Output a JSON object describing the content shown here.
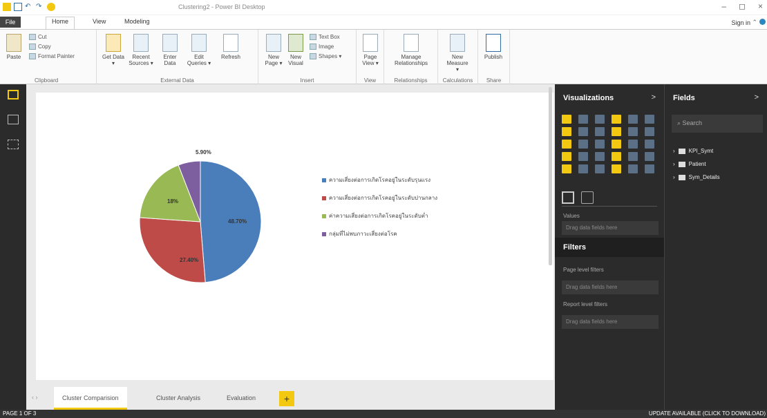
{
  "app": {
    "title": "Clustering2 - Power BI Desktop",
    "sign_in": "Sign in"
  },
  "ribbon_tabs": [
    "File",
    "Home",
    "View",
    "Modeling"
  ],
  "ribbon": {
    "clipboard": {
      "label": "Clipboard",
      "paste": "Paste",
      "cut": "Cut",
      "copy": "Copy",
      "format_painter": "Format Painter"
    },
    "external_data": {
      "label": "External Data",
      "get_data": "Get Data ▾",
      "recent_sources": "Recent Sources ▾",
      "enter_data": "Enter Data",
      "edit_queries": "Edit Queries ▾",
      "refresh": "Refresh"
    },
    "insert": {
      "label": "Insert",
      "new_page": "New Page ▾",
      "new_visual": "New Visual",
      "text_box": "Text Box",
      "image": "Image",
      "shapes": "Shapes ▾"
    },
    "view": {
      "label": "View",
      "page_view": "Page View ▾"
    },
    "relationships": {
      "label": "Relationships",
      "manage": "Manage Relationships"
    },
    "calculations": {
      "label": "Calculations",
      "new_measure": "New Measure ▾"
    },
    "share": {
      "label": "Share",
      "publish": "Publish"
    }
  },
  "chart_data": {
    "type": "pie",
    "slices": [
      {
        "label": "ความเสี่ยงต่อการเกิดโรคอยู่ในระดับรุนแรง",
        "value": 48.7,
        "data_label": "48.70%",
        "color": "#4a7ebb"
      },
      {
        "label": "ความเสี่ยงต่อการเกิดโรคอยู่ในระดับปานกลาง",
        "value": 27.4,
        "data_label": "27.40%",
        "color": "#be4b48"
      },
      {
        "label": "ค่าความเสี่ยงต่อการเกิดโรคอยู่ในระดับต่ำ",
        "value": 18,
        "data_label": "18%",
        "color": "#98b954"
      },
      {
        "label": "กลุ่มที่ไม่พบภาวะเสี่ยงต่อโรค",
        "value": 5.9,
        "data_label": "5.90%",
        "color": "#7d5fa0"
      }
    ],
    "legend_position": "right"
  },
  "page_tabs": [
    "Cluster Comparision",
    "Cluster  Analysis",
    "Evaluation"
  ],
  "add_page": "+",
  "status": {
    "page": "PAGE 1 OF 3",
    "update": "UPDATE AVAILABLE (CLICK TO DOWNLOAD)"
  },
  "viz_pane": {
    "title": "Visualizations",
    "chevron": ">",
    "values_label": "Values",
    "drop_here": "Drag data fields here",
    "filters_title": "Filters",
    "page_filters": "Page level filters",
    "page_drop": "Drag data fields here",
    "report_filters": "Report level filters",
    "report_drop": "Drag data fields here"
  },
  "fields_pane": {
    "title": "Fields",
    "chevron": ">",
    "search_placeholder": "Search",
    "tables": [
      "KPI_Symt",
      "Patient",
      "Sym_Details"
    ]
  },
  "colors": {
    "accent": "#f2c811",
    "pane_bg": "#2b2b2b"
  }
}
